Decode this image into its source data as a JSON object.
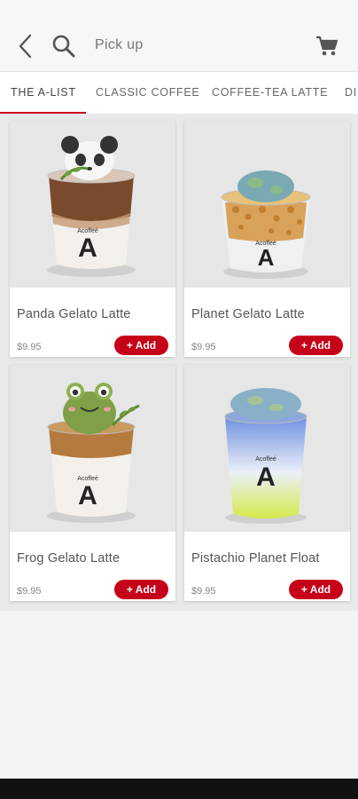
{
  "header": {
    "mode_label": "Pick up"
  },
  "tabs": [
    {
      "label": "THE A-LIST",
      "active": true
    },
    {
      "label": "CLASSIC COFFEE",
      "active": false
    },
    {
      "label": "COFFEE-TEA LATTE",
      "active": false
    },
    {
      "label": "DI",
      "active": false
    }
  ],
  "products": [
    {
      "name": "Panda Gelato Latte",
      "price": "$9.95",
      "add_label": "+ Add",
      "cup_brand": "Acoffeé",
      "cup_logo": "A"
    },
    {
      "name": "Planet Gelato Latte",
      "price": "$9.95",
      "add_label": "+ Add",
      "cup_brand": "Acoffeé",
      "cup_logo": "A"
    },
    {
      "name": "Frog Gelato Latte",
      "price": "$9.95",
      "add_label": "+ Add",
      "cup_brand": "Acoffeé",
      "cup_logo": "A"
    },
    {
      "name": "Pistachio Planet Float",
      "price": "$9.95",
      "add_label": "+ Add",
      "cup_brand": "Acoffeé",
      "cup_logo": "A"
    }
  ],
  "colors": {
    "accent": "#c60018",
    "tab_underline": "#c7001e"
  },
  "icons": {
    "back": "chevron-left-icon",
    "search": "search-icon",
    "cart": "cart-icon"
  }
}
